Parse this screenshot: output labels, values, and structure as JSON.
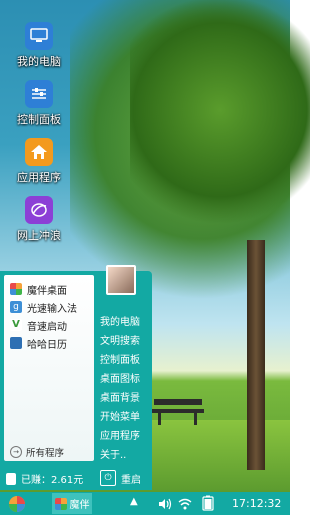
{
  "desktop": {
    "icons": [
      {
        "label": "我的电脑",
        "icon": "computer-icon"
      },
      {
        "label": "控制面板",
        "icon": "control-panel-icon"
      },
      {
        "label": "应用程序",
        "icon": "home-apps-icon"
      },
      {
        "label": "网上冲浪",
        "icon": "browser-icon"
      }
    ]
  },
  "start_menu": {
    "pinned": [
      {
        "label": "魔伴桌面",
        "icon": "magic-desktop-icon",
        "color": "#f6a13a"
      },
      {
        "label": "光速输入法",
        "icon": "input-method-icon",
        "color": "#3d8fd6"
      },
      {
        "label": "音速启动",
        "icon": "launcher-icon",
        "color": "#3a9a3a"
      },
      {
        "label": "哈哈日历",
        "icon": "calendar-icon",
        "color": "#2d6fb3"
      }
    ],
    "all_programs": "所有程序",
    "menu_items": [
      "我的电脑",
      "文明搜索",
      "控制面板",
      "桌面图标",
      "桌面背景",
      "开始菜单",
      "应用程序",
      "关于.."
    ],
    "earned": "已赚：2.61元",
    "restart": "重启"
  },
  "taskbar": {
    "app_label": "魔伴",
    "tray_arrow": "▲",
    "time": "17:12:32"
  },
  "colors": {
    "accent": "#13a9a3"
  }
}
